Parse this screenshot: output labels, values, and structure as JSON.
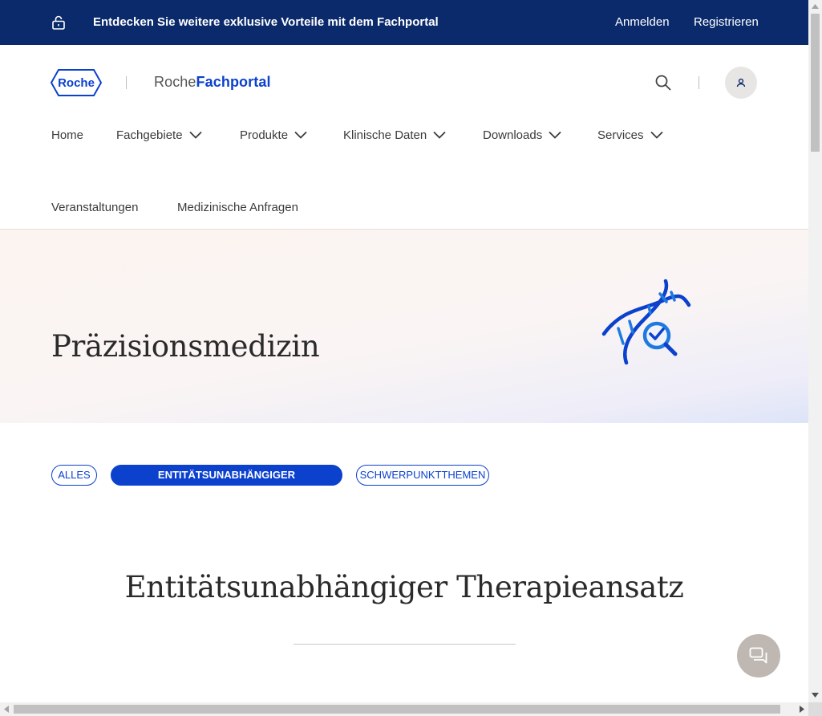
{
  "topbar": {
    "promo_text": "Entdecken Sie weitere exklusive Vorteile mit dem Fachportal",
    "login_label": "Anmelden",
    "register_label": "Registrieren",
    "background": "#0b2a6b"
  },
  "header": {
    "logo_text": "Roche",
    "brand_light": "Roche",
    "brand_bold": "Fachportal",
    "accent": "#0b41cd"
  },
  "nav": {
    "items": [
      {
        "label": "Home",
        "dropdown": false
      },
      {
        "label": "Fachgebiete",
        "dropdown": true
      },
      {
        "label": "Produkte",
        "dropdown": true
      },
      {
        "label": "Klinische Daten",
        "dropdown": true
      },
      {
        "label": "Downloads",
        "dropdown": true
      },
      {
        "label": "Services",
        "dropdown": true
      },
      {
        "label": "Veranstaltungen",
        "dropdown": false
      },
      {
        "label": "Medizinische Anfragen",
        "dropdown": false
      }
    ]
  },
  "hero": {
    "title": "Präzisionsmedizin",
    "icon": "dna-magnifier-icon"
  },
  "filters": {
    "chips": [
      {
        "label": "ALLES",
        "active": false
      },
      {
        "label": "ENTITÄTSUNABHÄNGIGER THERAPIEANSATZ",
        "active": true
      },
      {
        "label": "SCHWERPUNKTTHEMEN",
        "active": false
      }
    ]
  },
  "section": {
    "title": "Entitätsunabhängiger Therapieansatz"
  }
}
